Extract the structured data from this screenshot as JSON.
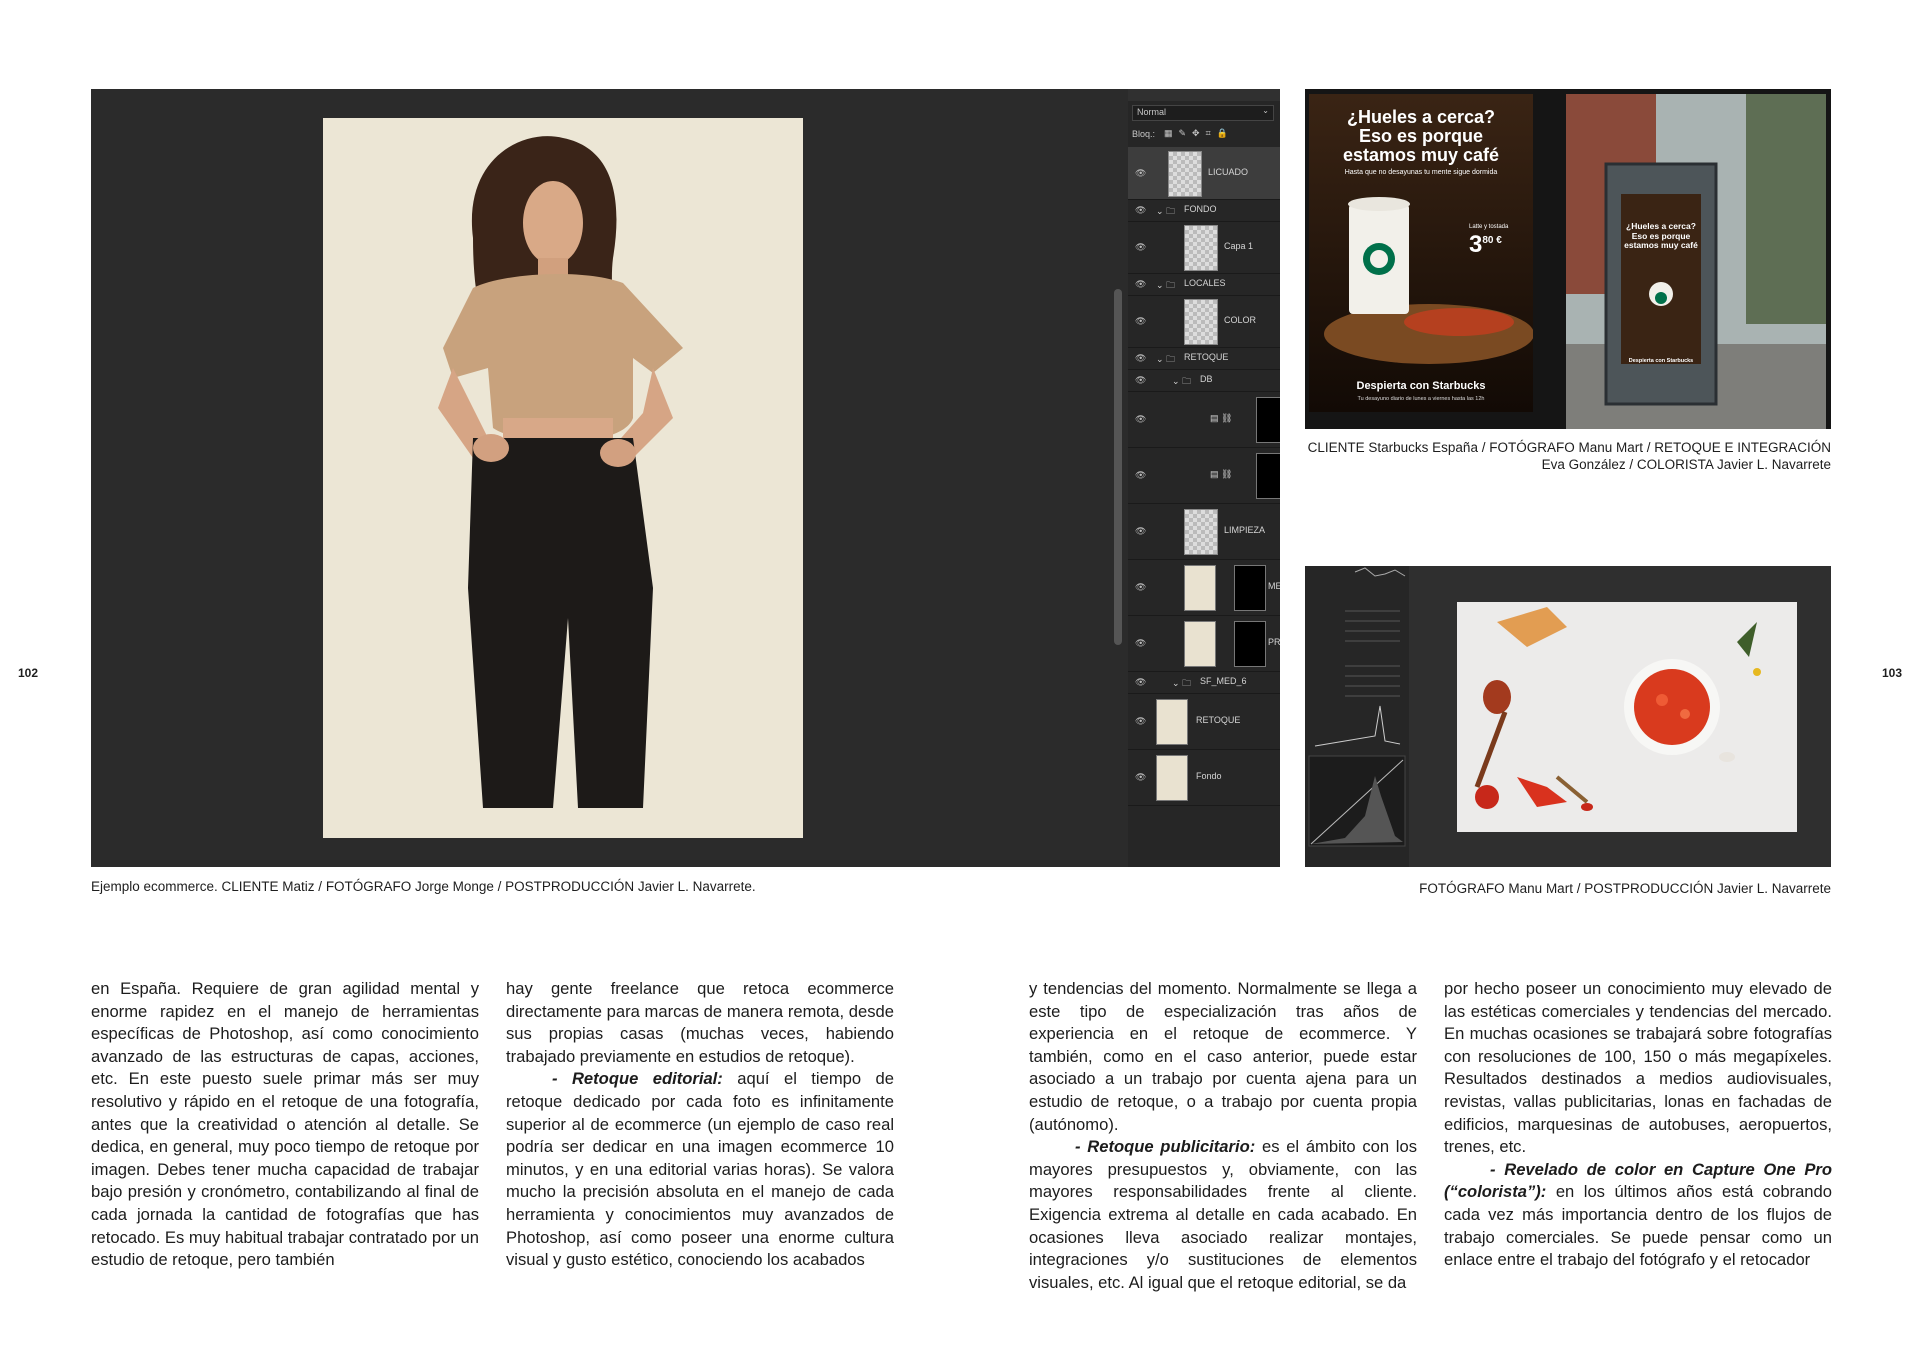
{
  "page_left_number": "102",
  "page_right_number": "103",
  "figures": {
    "ecommerce": {
      "caption": "Ejemplo ecommerce. CLIENTE Matiz / FOTÓGRAFO Jorge Monge / POSTPRODUCCIÓN Javier L. Navarrete.",
      "blend_mode": "Normal",
      "lock_label": "Bloq.:",
      "layers": [
        {
          "name": "LICUADO",
          "kind": "transparent"
        },
        {
          "name": "FONDO",
          "kind": "group"
        },
        {
          "name": "Capa 1",
          "kind": "transparent"
        },
        {
          "name": "LOCALES",
          "kind": "group"
        },
        {
          "name": "COLOR",
          "kind": "transparent"
        },
        {
          "name": "RETOQUE",
          "kind": "group"
        },
        {
          "name": "DB",
          "kind": "group"
        },
        {
          "name": "",
          "kind": "adjustment"
        },
        {
          "name": "",
          "kind": "adjustment"
        },
        {
          "name": "LIMPIEZA",
          "kind": "transparent"
        },
        {
          "name": "ME",
          "kind": "photo-mask"
        },
        {
          "name": "PR",
          "kind": "photo-mask"
        },
        {
          "name": "SF_MED_6",
          "kind": "group"
        },
        {
          "name": "RETOQUE",
          "kind": "photo"
        },
        {
          "name": "Fondo",
          "kind": "photo"
        }
      ]
    },
    "starbucks": {
      "caption_line1": "CLIENTE Starbucks España / FOTÓGRAFO Manu Mart / RETOQUE E INTEGRACIÓN",
      "caption_line2": "Eva González / COLORISTA Javier L. Navarrete",
      "ad_headline_1": "¿Hueles a cerca?",
      "ad_headline_2": "Eso es porque",
      "ad_headline_3": "estamos muy café",
      "ad_sub": "Hasta que no desayunas tu mente sigue dormida",
      "ad_price_label": "Latte y tostada",
      "ad_price": "3",
      "ad_price_cents": "80 €",
      "ad_footer": "Despierta con Starbucks",
      "ad_footer_sub": "Tu desayuno diario de lunes a viernes hasta las 12h",
      "ad_small_footer": "Despierta con Starbucks"
    },
    "capture_one": {
      "caption": "FOTÓGRAFO Manu Mart / POSTPRODUCCIÓN Javier L. Navarrete"
    }
  },
  "columns": {
    "c1": "en España. Requiere de gran agilidad mental y enorme rapidez en el manejo de herramientas específicas de Photoshop, así como conocimiento avanzado de las estructuras de capas, acciones, etc. En este puesto suele primar más ser muy resolutivo y rápido en el retoque de una fotografía, antes que la creatividad o atención al detalle. Se dedica, en general, muy poco tiempo de retoque por imagen. Debes tener mucha capacidad de trabajar bajo presión y cronómetro, contabilizando al final de cada jornada la cantidad de fotografías que has retocado. Es muy habitual trabajar contratado por un estudio de retoque, pero también",
    "c2_p1": "hay gente freelance que retoca ecommerce directamente para marcas de manera remota, desde sus propias casas (muchas veces, habiendo trabajado previamente en estudios de retoque).",
    "c2_p2_lead": "- Retoque editorial:",
    "c2_p2": " aquí el tiempo de retoque dedicado por cada foto es infinitamente superior al de ecommerce (un ejemplo de caso real podría ser dedicar en una imagen ecommerce 10 minutos, y en una editorial varias horas). Se valora mucho la precisión absoluta en el manejo de cada herramienta y conocimientos muy avanzados de Photoshop, así como poseer una enorme cultura visual y gusto estético, conociendo los acabados",
    "c3_p1": "y tendencias del momento. Normalmente se llega a este tipo de especialización tras años de experiencia en el retoque de ecommerce. Y también, como en el caso anterior, puede estar asociado a un trabajo por cuenta ajena para un estudio de retoque, o a trabajo por cuenta propia (autónomo).",
    "c3_p2_lead": "- Retoque publicitario:",
    "c3_p2": " es el ámbito con los mayores presupuestos y, obviamente, con las mayores responsabilidades frente al cliente. Exigencia extrema al detalle en cada acabado. En ocasiones lleva asociado realizar montajes, integraciones y/o sustituciones de elementos visuales, etc. Al igual que el retoque editorial, se da",
    "c4_p1": "por hecho poseer un conocimiento muy elevado de las estéticas comerciales y tendencias del mercado. En muchas ocasiones se trabajará sobre fotografías con resoluciones de 100, 150 o más megapíxeles. Resultados destinados a medios audiovisuales, revistas, vallas publicitarias, lonas en fachadas de edificios, marquesinas de autobuses, aeropuertos, trenes, etc.",
    "c4_p2_lead": "- Revelado de color en Capture One Pro (“colorista”):",
    "c4_p2": " en los últimos años está cobrando cada vez más importancia dentro de los flujos de trabajo comerciales. Se puede pensar como un enlace entre el trabajo del fotógrafo y el retocador"
  }
}
